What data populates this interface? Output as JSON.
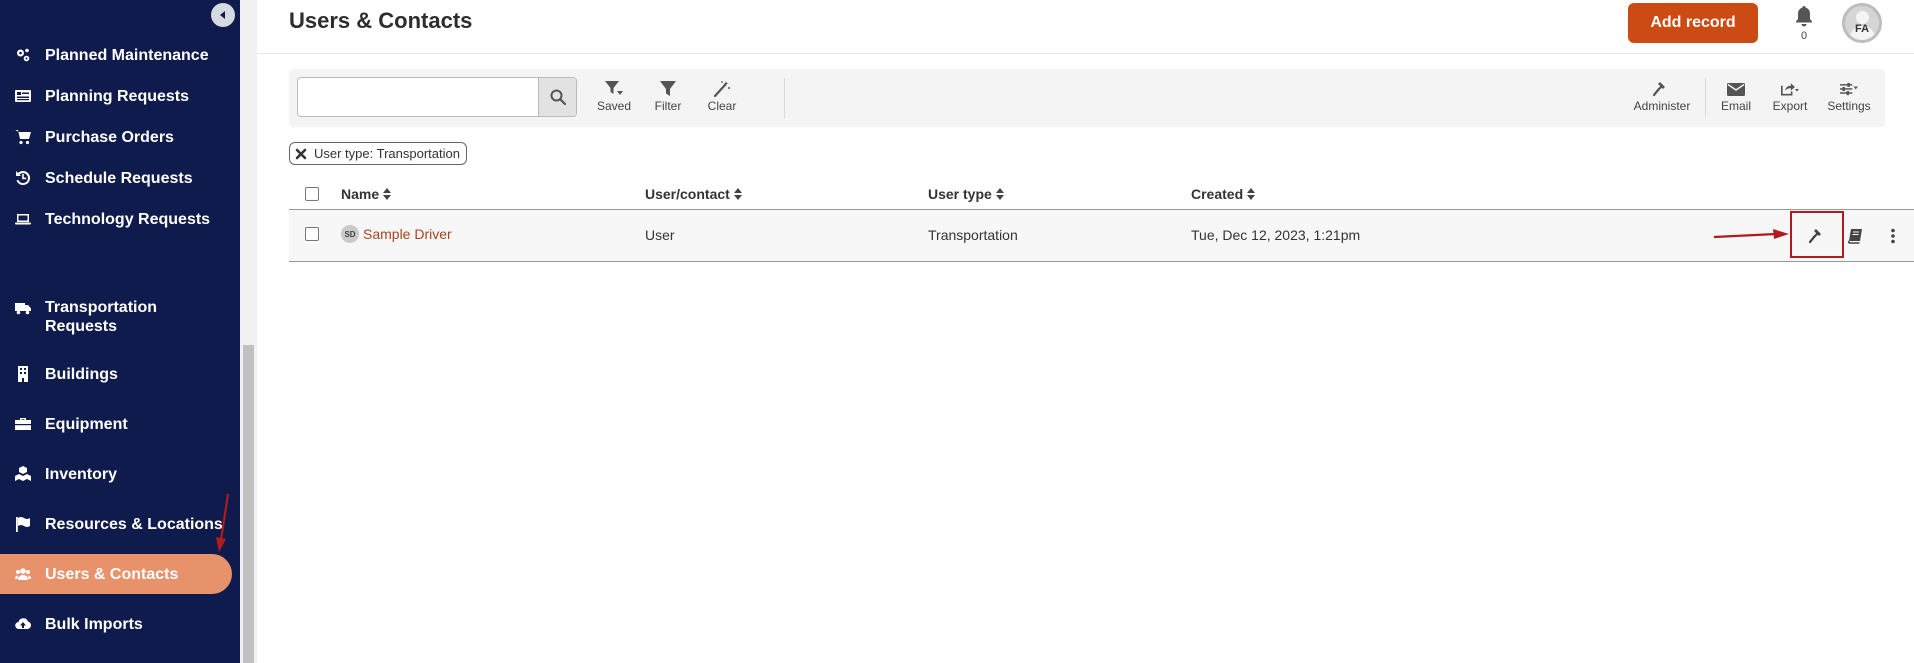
{
  "sidebar": {
    "items": [
      {
        "label": "Planned Maintenance",
        "icon": "gears-icon"
      },
      {
        "label": "Planning Requests",
        "icon": "list-card-icon"
      },
      {
        "label": "Purchase Orders",
        "icon": "cart-icon"
      },
      {
        "label": "Schedule Requests",
        "icon": "history-icon"
      },
      {
        "label": "Technology Requests",
        "icon": "laptop-icon"
      },
      {
        "label": "Transportation Requests",
        "icon": "truck-icon"
      },
      {
        "label": "Buildings",
        "icon": "building-icon"
      },
      {
        "label": "Equipment",
        "icon": "toolbox-icon"
      },
      {
        "label": "Inventory",
        "icon": "boxes-icon"
      },
      {
        "label": "Resources & Locations",
        "icon": "flag-icon"
      },
      {
        "label": "Users & Contacts",
        "icon": "users-icon",
        "active": true
      },
      {
        "label": "Bulk Imports",
        "icon": "cloud-upload-icon"
      }
    ]
  },
  "header": {
    "title": "Users & Contacts",
    "add_record_label": "Add record",
    "notification_count": "0",
    "user_initials": "FA"
  },
  "toolbar": {
    "search_value": "",
    "saved_label": "Saved",
    "filter_label": "Filter",
    "clear_label": "Clear",
    "administer_label": "Administer",
    "email_label": "Email",
    "export_label": "Export",
    "settings_label": "Settings"
  },
  "filter_chip": {
    "label": "User type: Transportation"
  },
  "table": {
    "columns": [
      "Name",
      "User/contact",
      "User type",
      "Created"
    ],
    "rows": [
      {
        "initials": "SD",
        "name": "Sample Driver",
        "user_contact": "User",
        "user_type": "Transportation",
        "created": "Tue, Dec 12, 2023, 1:21pm"
      }
    ]
  },
  "colors": {
    "sidebar_bg": "#0f1b4c",
    "active_item": "#e8926c",
    "primary_button": "#cc4b14",
    "link": "#a8441c",
    "annotation": "#b01b1b"
  }
}
